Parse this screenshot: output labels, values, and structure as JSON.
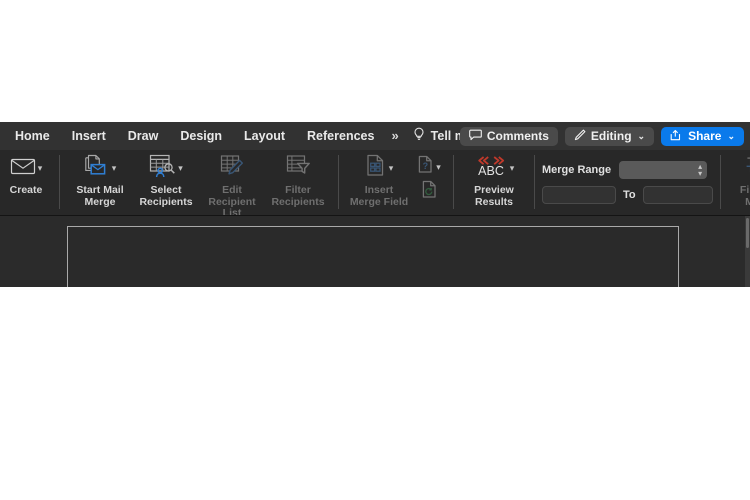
{
  "app": {
    "theme_background": "#282828",
    "accent_color": "#0a7aeb",
    "page_background": "#2a2a2a"
  },
  "tabs": [
    {
      "label": "Home",
      "name": "tab-home"
    },
    {
      "label": "Insert",
      "name": "tab-insert"
    },
    {
      "label": "Draw",
      "name": "tab-draw"
    },
    {
      "label": "Design",
      "name": "tab-design"
    },
    {
      "label": "Layout",
      "name": "tab-layout"
    },
    {
      "label": "References",
      "name": "tab-references"
    }
  ],
  "tabbar": {
    "overflow_label": "»",
    "tellme_label": "Tell me",
    "tellme_icon": "lightbulb-icon"
  },
  "top_right": {
    "comments_label": "Comments",
    "comments_icon": "comment-bubble-icon",
    "editing_label": "Editing",
    "editing_icon": "pencil-icon",
    "editing_caret": "⌄",
    "share_label": "Share",
    "share_icon": "share-arrow-icon",
    "share_caret": "⌄"
  },
  "ribbon": {
    "groups": [
      {
        "name": "create-group",
        "controls": [
          {
            "name": "create-button",
            "label": "Create",
            "icon": "envelope-icon",
            "has_caret": true,
            "enabled": true
          }
        ]
      },
      {
        "name": "mail-merge-group",
        "controls": [
          {
            "name": "start-mail-merge-button",
            "label": "Start Mail\nMerge",
            "icon": "documents-envelope-icon",
            "has_caret": true,
            "enabled": true
          },
          {
            "name": "select-recipients-button",
            "label": "Select\nRecipients",
            "icon": "table-person-search-icon",
            "has_caret": true,
            "enabled": true
          },
          {
            "name": "edit-recipient-list-button",
            "label": "Edit\nRecipient List",
            "icon": "table-pencil-icon",
            "has_caret": false,
            "enabled": false
          },
          {
            "name": "filter-recipients-button",
            "label": "Filter\nRecipients",
            "icon": "table-funnel-icon",
            "has_caret": false,
            "enabled": false
          }
        ]
      },
      {
        "name": "write-insert-fields-group",
        "controls": [
          {
            "name": "insert-merge-field-button",
            "label": "Insert\nMerge Field",
            "icon": "document-fields-icon",
            "has_caret": true,
            "enabled": false
          }
        ],
        "stacked": [
          {
            "name": "match-fields-button",
            "icon": "document-question-icon",
            "has_caret": true,
            "enabled": false
          },
          {
            "name": "update-labels-button",
            "icon": "document-refresh-icon",
            "has_caret": false,
            "enabled": false
          }
        ]
      },
      {
        "name": "preview-results-group",
        "controls": [
          {
            "name": "preview-results-button",
            "label": "Preview\nResults",
            "icon": "abc-preview-icon",
            "icon_text": "ABC",
            "has_caret": true,
            "enabled": true
          }
        ]
      },
      {
        "name": "merge-range-group",
        "range_label": "Merge Range",
        "range_value": "",
        "from_value": "",
        "to_label": "To",
        "to_value": "",
        "stepper_up": "▴",
        "stepper_down": "▾"
      },
      {
        "name": "finish-group",
        "controls": [
          {
            "name": "finish-and-merge-button",
            "label": "Finish &\nMerge",
            "icon": "document-arrow-icon",
            "has_caret": true,
            "enabled": false
          }
        ]
      }
    ]
  },
  "document": {
    "page_name": "document-page",
    "content": ""
  }
}
